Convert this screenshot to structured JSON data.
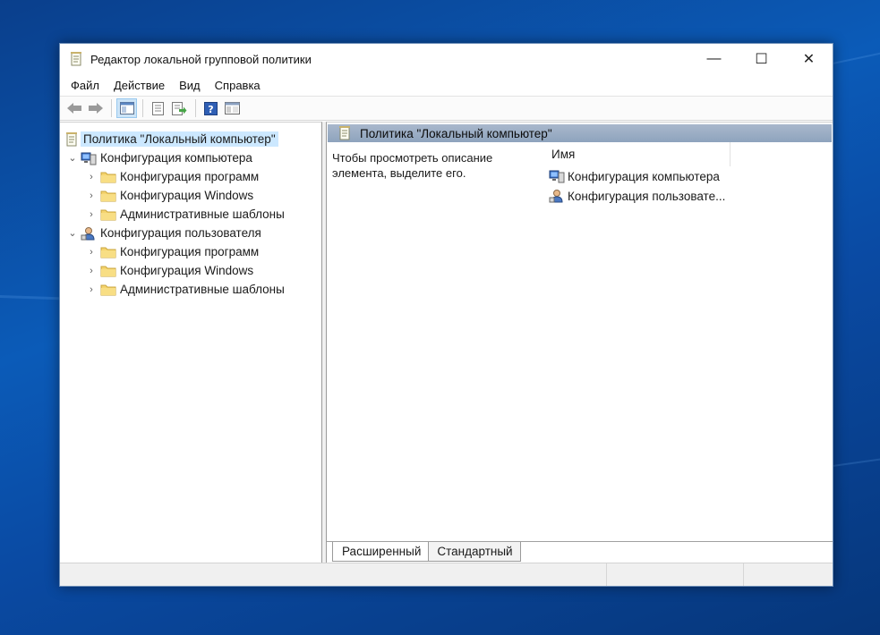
{
  "window": {
    "title": "Редактор локальной групповой политики",
    "controls": {
      "minimize": "—",
      "maximize": "☐",
      "close": "✕"
    }
  },
  "menu": {
    "items": [
      {
        "label": "Файл"
      },
      {
        "label": "Действие"
      },
      {
        "label": "Вид"
      },
      {
        "label": "Справка"
      }
    ]
  },
  "toolbar": {
    "buttons": [
      "back-arrow-icon",
      "forward-arrow-icon",
      "show-hide-tree-icon",
      "properties-icon",
      "export-list-icon",
      "help-icon",
      "extended-view-icon"
    ]
  },
  "tree": {
    "root": {
      "label": "Политика \"Локальный компьютер\""
    },
    "computer": {
      "label": "Конфигурация компьютера",
      "children": [
        {
          "label": "Конфигурация программ"
        },
        {
          "label": "Конфигурация Windows"
        },
        {
          "label": "Административные шаблоны"
        }
      ]
    },
    "user": {
      "label": "Конфигурация пользователя",
      "children": [
        {
          "label": "Конфигурация программ"
        },
        {
          "label": "Конфигурация Windows"
        },
        {
          "label": "Административные шаблоны"
        }
      ]
    }
  },
  "right": {
    "header": "Политика \"Локальный компьютер\"",
    "description_line1": "Чтобы просмотреть описание",
    "description_line2": "элемента, выделите его.",
    "column_name": "Имя",
    "items": [
      {
        "label": "Конфигурация компьютера"
      },
      {
        "label": "Конфигурация пользовате..."
      }
    ]
  },
  "tabs": [
    {
      "label": "Расширенный",
      "active": true
    },
    {
      "label": "Стандартный",
      "active": false
    }
  ],
  "colors": {
    "selection": "#cce8ff",
    "header_band": "#9aabc2",
    "desktop": "#0b5bb8"
  }
}
